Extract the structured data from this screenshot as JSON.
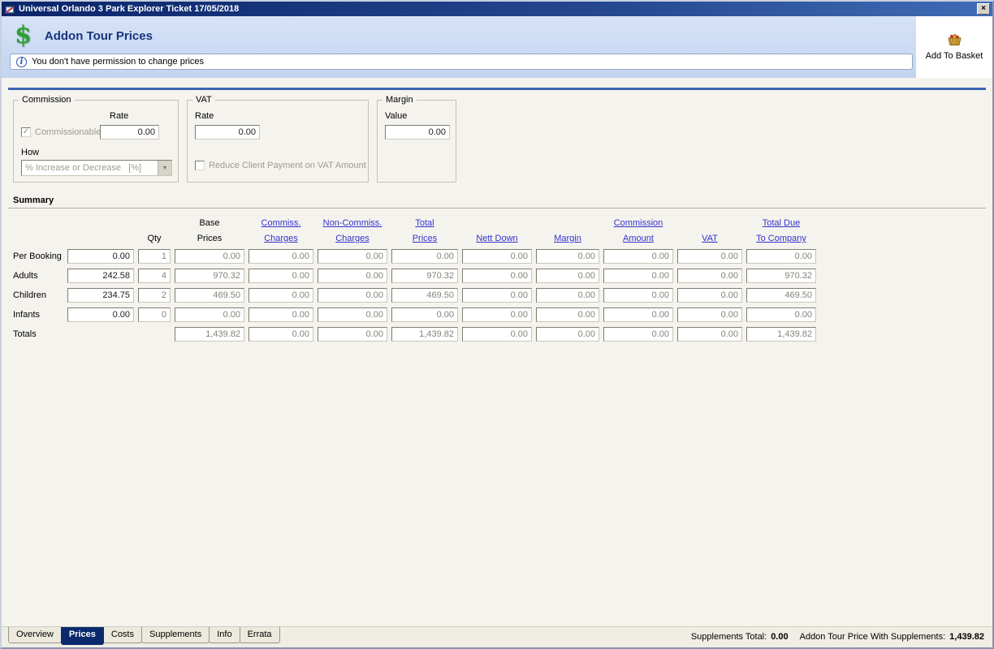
{
  "window": {
    "title": "Universal Orlando 3 Park Explorer Ticket 17/05/2018"
  },
  "icons": {
    "dollar": "$",
    "info": "i",
    "close": "×",
    "check": "✓",
    "arrow_down": "▼"
  },
  "header": {
    "title": "Addon Tour Prices",
    "add_to_basket": "Add To Basket",
    "notice": "You don't have permission to change prices"
  },
  "panels": {
    "commission": {
      "legend": "Commission",
      "rate_label": "Rate",
      "rate_value": "0.00",
      "commissionable_label": "Commissionable",
      "commissionable_checked": true,
      "how_label": "How",
      "how_value": "% Increase or Decrease   [%]"
    },
    "vat": {
      "legend": "VAT",
      "rate_label": "Rate",
      "rate_value": "0.00",
      "reduce_label": "Reduce Client Payment on VAT Amount",
      "reduce_checked": false
    },
    "margin": {
      "legend": "Margin",
      "value_label": "Value",
      "value": "0.00"
    }
  },
  "summary": {
    "title": "Summary",
    "header_line1": {
      "base": "Base",
      "commiss": "Commiss.",
      "noncommiss": "Non-Commiss.",
      "total": "Total",
      "commission": "Commission",
      "totaldue": "Total Due"
    },
    "header_line2": {
      "qty": "Qty",
      "base": "Prices",
      "commiss": "Charges",
      "noncommiss": "Charges",
      "total": "Prices",
      "nettdown": "Nett Down",
      "margin": "Margin",
      "commission": "Amount",
      "vat": "VAT",
      "totaldue": "To Company"
    },
    "rows": [
      {
        "label": "Per Booking",
        "unit": "0.00",
        "qty": "1",
        "base": "0.00",
        "commiss": "0.00",
        "noncommiss": "0.00",
        "total": "0.00",
        "nettdown": "0.00",
        "margin": "0.00",
        "commission": "0.00",
        "vat": "0.00",
        "totaldue": "0.00"
      },
      {
        "label": "Adults",
        "unit": "242.58",
        "qty": "4",
        "base": "970.32",
        "commiss": "0.00",
        "noncommiss": "0.00",
        "total": "970.32",
        "nettdown": "0.00",
        "margin": "0.00",
        "commission": "0.00",
        "vat": "0.00",
        "totaldue": "970.32"
      },
      {
        "label": "Children",
        "unit": "234.75",
        "qty": "2",
        "base": "469.50",
        "commiss": "0.00",
        "noncommiss": "0.00",
        "total": "469.50",
        "nettdown": "0.00",
        "margin": "0.00",
        "commission": "0.00",
        "vat": "0.00",
        "totaldue": "469.50"
      },
      {
        "label": "Infants",
        "unit": "0.00",
        "qty": "0",
        "base": "0.00",
        "commiss": "0.00",
        "noncommiss": "0.00",
        "total": "0.00",
        "nettdown": "0.00",
        "margin": "0.00",
        "commission": "0.00",
        "vat": "0.00",
        "totaldue": "0.00"
      }
    ],
    "totals": {
      "label": "Totals",
      "base": "1,439.82",
      "commiss": "0.00",
      "noncommiss": "0.00",
      "total": "1,439.82",
      "nettdown": "0.00",
      "margin": "0.00",
      "commission": "0.00",
      "vat": "0.00",
      "totaldue": "1,439.82"
    }
  },
  "tabs": [
    {
      "label": "Overview",
      "active": false
    },
    {
      "label": "Prices",
      "active": true
    },
    {
      "label": "Costs",
      "active": false
    },
    {
      "label": "Supplements",
      "active": false
    },
    {
      "label": "Info",
      "active": false
    },
    {
      "label": "Errata",
      "active": false
    }
  ],
  "statusbar": {
    "supplements_total_label": "Supplements Total:",
    "supplements_total_value": "0.00",
    "price_with_supplements_label": "Addon Tour Price With Supplements:",
    "price_with_supplements_value": "1,439.82"
  },
  "colors": {
    "titlebar": "#0a246a",
    "header_bg": "#cdd9ee",
    "accent_line": "#3c64b4",
    "link": "#3333cc",
    "active_tab": "#0b2a6e",
    "dollar_green": "#2f9e35"
  }
}
